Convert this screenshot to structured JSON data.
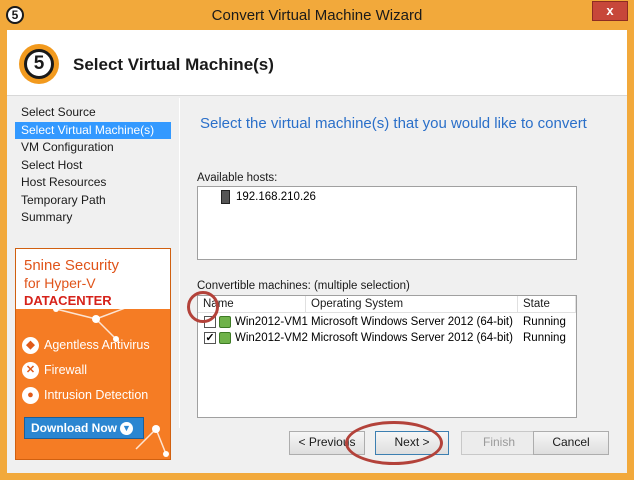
{
  "window": {
    "title": "Convert Virtual Machine Wizard",
    "logo_text": "5",
    "close_label": "x"
  },
  "header": {
    "step_number": "5",
    "title": "Select Virtual Machine(s)"
  },
  "nav": {
    "items": [
      {
        "label": "Select Source"
      },
      {
        "label": "Select Virtual Machine(s)"
      },
      {
        "label": "VM Configuration"
      },
      {
        "label": "Select Host"
      },
      {
        "label": "Host Resources"
      },
      {
        "label": "Temporary Path"
      },
      {
        "label": "Summary"
      }
    ],
    "active_index": 1
  },
  "ad": {
    "line1": "5nine Security",
    "line2": "for Hyper-V",
    "line3": "DATACENTER",
    "features": [
      "Agentless Antivirus",
      "Firewall",
      "Intrusion Detection"
    ],
    "download_label": "Download Now"
  },
  "content": {
    "instruction": "Select the virtual machine(s) that you would like to convert",
    "hosts_label": "Available hosts:",
    "hosts": [
      "192.168.210.26"
    ],
    "machines_label": "Convertible machines: (multiple selection)",
    "columns": [
      "Name",
      "Operating System",
      "State"
    ],
    "machines": [
      {
        "name": "Win2012-VM1",
        "os": "Microsoft Windows Server 2012 (64-bit)",
        "state": "Running",
        "checked": false
      },
      {
        "name": "Win2012-VM2",
        "os": "Microsoft Windows Server 2012 (64-bit)",
        "state": "Running",
        "checked": true
      }
    ]
  },
  "buttons": {
    "previous": "< Previous",
    "next": "Next >",
    "finish": "Finish",
    "cancel": "Cancel"
  },
  "colors": {
    "frame": "#f2a93b",
    "accent_blue": "#2a6fc9",
    "selection": "#3399ff",
    "highlight_annotation": "#b3423a"
  }
}
